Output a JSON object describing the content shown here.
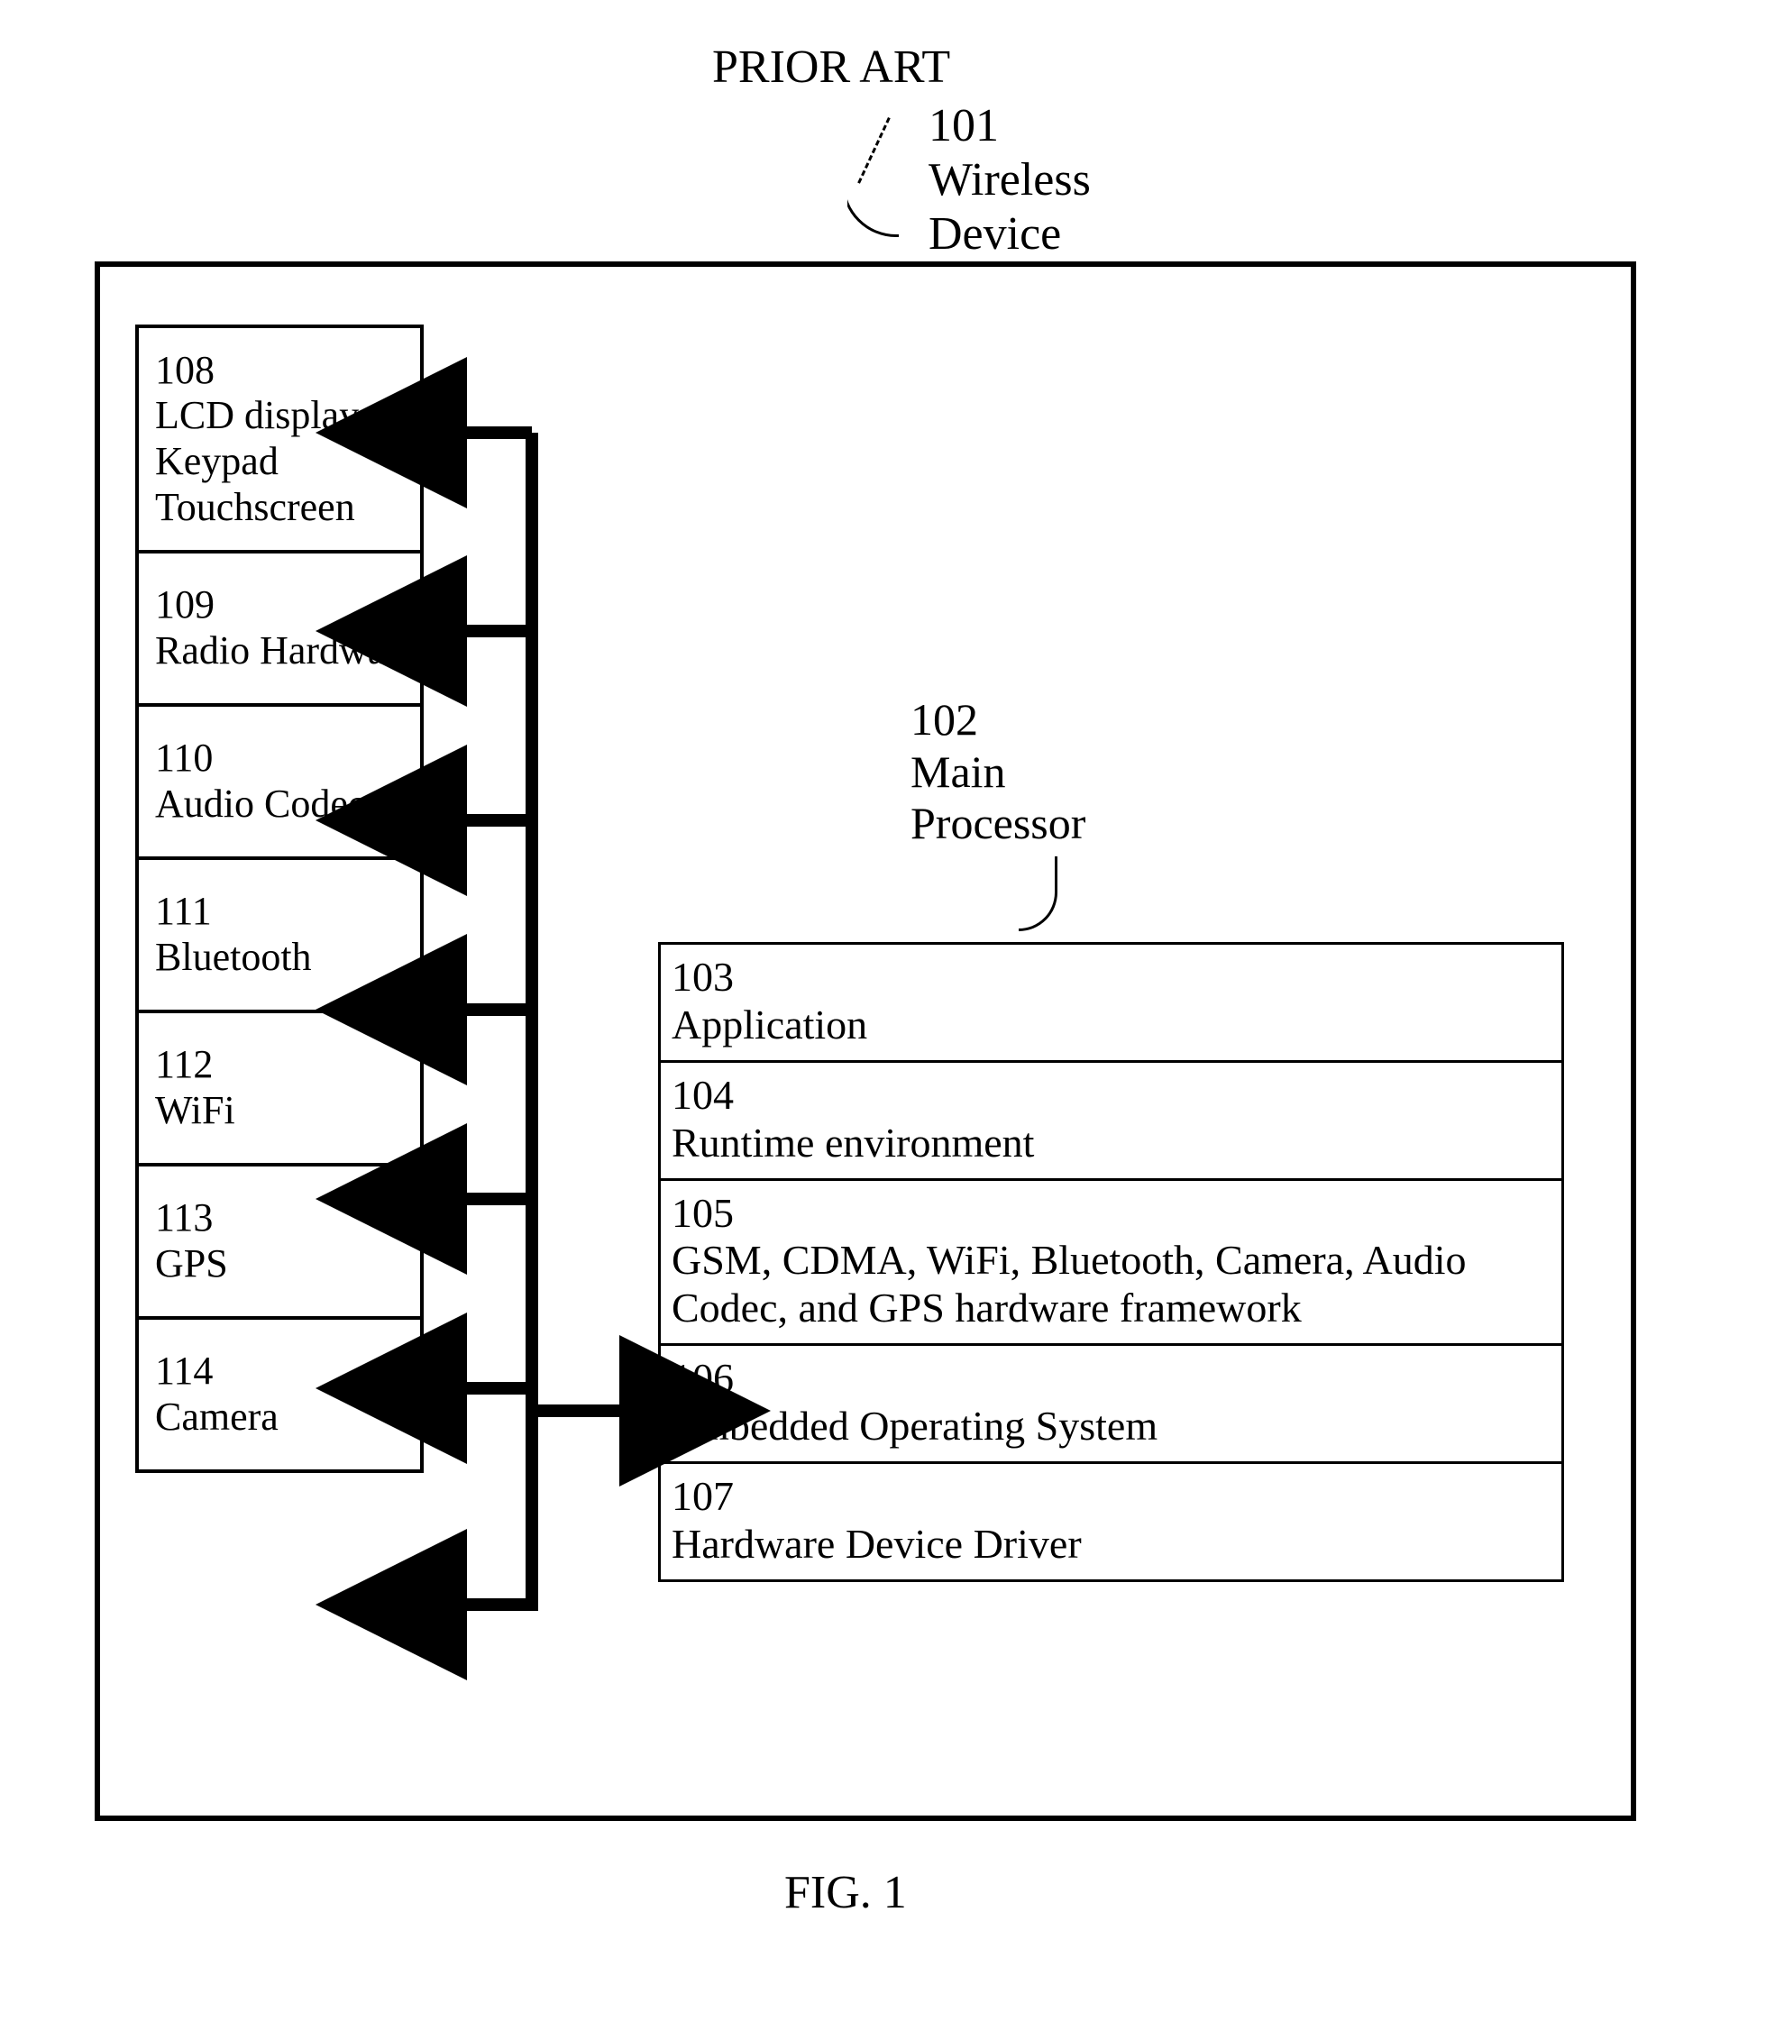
{
  "header": {
    "prior_art": "PRIOR ART",
    "ref_101_num": "101",
    "ref_101_label": "Wireless\nDevice"
  },
  "peripherals": [
    {
      "num": "108",
      "label": "LCD display\nKeypad\nTouchscreen"
    },
    {
      "num": "109",
      "label": "Radio Hardware"
    },
    {
      "num": "110",
      "label": "Audio Codec"
    },
    {
      "num": "111",
      "label": "Bluetooth"
    },
    {
      "num": "112",
      "label": "WiFi"
    },
    {
      "num": "113",
      "label": "GPS"
    },
    {
      "num": "114",
      "label": "Camera"
    }
  ],
  "processor_label": {
    "num": "102",
    "label": "Main\nProcessor"
  },
  "processor_stack": [
    {
      "num": "103",
      "label": "Application"
    },
    {
      "num": "104",
      "label": "Runtime environment"
    },
    {
      "num": "105",
      "label": "GSM, CDMA, WiFi, Bluetooth, Camera, Audio Codec, and GPS hardware framework"
    },
    {
      "num": "106",
      "label": "Embedded Operating System"
    },
    {
      "num": "107",
      "label": "Hardware Device Driver"
    }
  ],
  "figure_caption": "FIG. 1"
}
